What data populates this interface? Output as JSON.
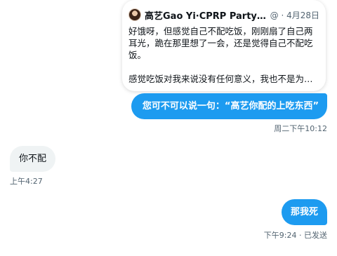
{
  "quoted_tweet": {
    "author": "高艺Gao Yi·CPRP Party Chai...",
    "meta": "@ · 4月28日",
    "text_line1": "好饿呀，但感觉自己不配吃饭，刚刚扇了自己两耳光，跪在那里想了一会，还是觉得自己不配吃饭。",
    "text_line2": "感觉吃饭对我来说没有任何意义，我也不是为了..."
  },
  "messages": [
    {
      "direction": "outgoing",
      "text": "您可不可以说一句：“高艺你配的上吃东西”",
      "timestamp": "周二下午10:12"
    },
    {
      "direction": "incoming",
      "text": "你不配",
      "timestamp": "上午4:27"
    },
    {
      "direction": "outgoing",
      "text": "那我死",
      "timestamp": "下午9:24 · 已发送"
    }
  ],
  "colors": {
    "outgoing_bubble": "#1d9bf0",
    "incoming_bubble": "#eff3f4",
    "timestamp_text": "#536471"
  }
}
